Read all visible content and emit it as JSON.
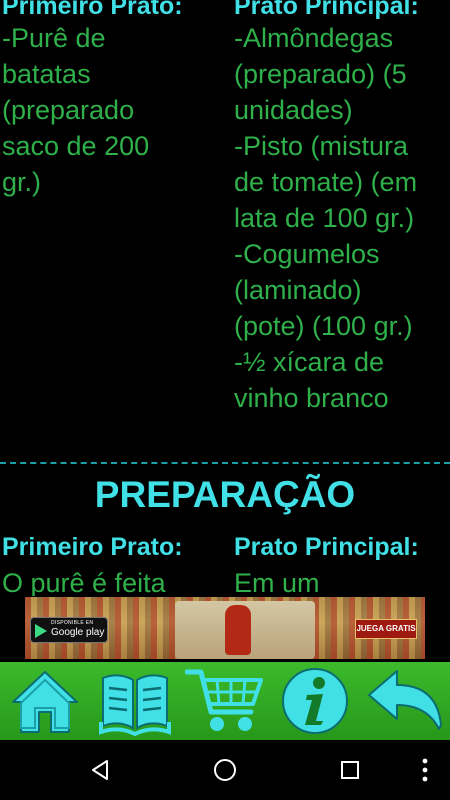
{
  "ingredients": {
    "left": {
      "heading": "Primeiro Prato:",
      "lines": [
        "-Purê de",
        "batatas",
        "(preparado",
        "saco de 200",
        "gr.)"
      ]
    },
    "right": {
      "heading": "Prato Principal:",
      "lines": [
        "-Almôndegas",
        "(preparado) (5",
        "unidades)",
        "-Pisto (mistura",
        "de tomate) (em",
        "lata de 100 gr.)",
        "-Cogumelos",
        "(laminado)",
        "(pote) (100 gr.)",
        "-½ xícara de",
        "vinho branco"
      ]
    }
  },
  "preparation": {
    "title": "PREPARAÇÃO",
    "left": {
      "heading": "Primeiro Prato:",
      "first_line": "O purê é feita"
    },
    "right": {
      "heading": "Prato Principal:",
      "first_line": "Em um"
    }
  },
  "ad": {
    "store_small": "DISPONIBLE EN",
    "store_big": "Google play",
    "cta": "JUEGA GRATIS"
  },
  "toolbar": {
    "items": [
      "home-icon",
      "book-icon",
      "cart-icon",
      "info-icon",
      "back-arrow-icon"
    ]
  },
  "colors": {
    "heading": "#40e0e6",
    "body_text": "#2fb04a",
    "toolbar_bg": "#2fa822",
    "icon_fill": "#40e0e6"
  }
}
